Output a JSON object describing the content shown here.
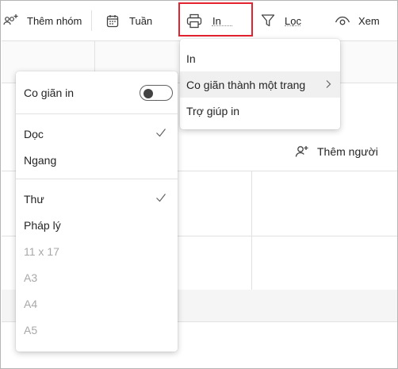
{
  "toolbar": {
    "add_group_label": "Thêm nhóm",
    "week_label": "Tuần",
    "print_label": "In",
    "filter_label": "Lọc",
    "view_label": "Xem",
    "icons": [
      "add-group-icon",
      "calendar-icon",
      "printer-icon",
      "filter-icon",
      "eye-icon"
    ]
  },
  "board": {
    "add_person_label": "Thêm người",
    "add_person_icon": "person-add-icon"
  },
  "print_menu": {
    "items": [
      {
        "label": "In"
      },
      {
        "label": "Co giãn thành một trang",
        "has_submenu": true,
        "active": true
      },
      {
        "label": "Trợ giúp in"
      }
    ]
  },
  "fit_menu": {
    "toggle": {
      "label": "Co giãn in",
      "on": false
    },
    "orientation": [
      {
        "label": "Dọc",
        "checked": true,
        "enabled": true
      },
      {
        "label": "Ngang",
        "checked": false,
        "enabled": true
      }
    ],
    "paper": [
      {
        "label": "Thư",
        "checked": true,
        "enabled": true
      },
      {
        "label": "Pháp lý",
        "checked": false,
        "enabled": true
      },
      {
        "label": "11 x 17",
        "checked": false,
        "enabled": false
      },
      {
        "label": "A3",
        "checked": false,
        "enabled": false
      },
      {
        "label": "A4",
        "checked": false,
        "enabled": false
      },
      {
        "label": "A5",
        "checked": false,
        "enabled": false
      }
    ]
  },
  "colors": {
    "highlight_border": "#e3232f",
    "text": "#242424",
    "disabled_text": "#a8a8a8",
    "menu_active_bg": "#f0f0f0"
  }
}
